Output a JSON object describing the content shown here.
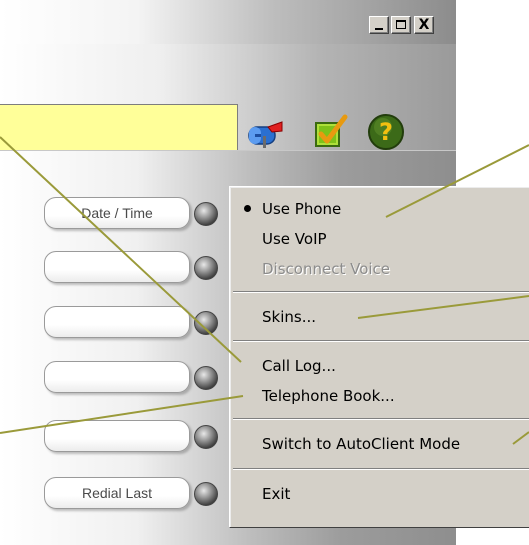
{
  "window": {
    "controls": {
      "minimize_icon": "minimize-icon",
      "maximize_icon": "maximize-icon",
      "close_label": "X"
    },
    "toolbar_icons": [
      "mailbox-icon",
      "check-icon",
      "help-icon",
      "collapse-arrow-icon"
    ],
    "display_field_color": "#ffff99"
  },
  "buttons": [
    {
      "label": "Date / Time"
    },
    {
      "label": ""
    },
    {
      "label": ""
    },
    {
      "label": ""
    },
    {
      "label": ""
    },
    {
      "label": "Redial Last"
    }
  ],
  "menu": {
    "items": [
      {
        "label": "Use Phone",
        "selected": true,
        "enabled": true
      },
      {
        "label": "Use VoIP",
        "selected": false,
        "enabled": true
      },
      {
        "label": "Disconnect Voice",
        "selected": false,
        "enabled": false
      },
      {
        "label": "Skins...",
        "enabled": true
      },
      {
        "label": "Call Log...",
        "enabled": true
      },
      {
        "label": "Telephone Book...",
        "enabled": true
      },
      {
        "label": "Switch to AutoClient Mode",
        "enabled": true
      },
      {
        "label": "Exit",
        "enabled": true
      }
    ]
  },
  "colors": {
    "callout_line": "#9a9a3a",
    "accent_arrow": "#2a7fd9",
    "menu_bg": "#d4d0c8"
  }
}
